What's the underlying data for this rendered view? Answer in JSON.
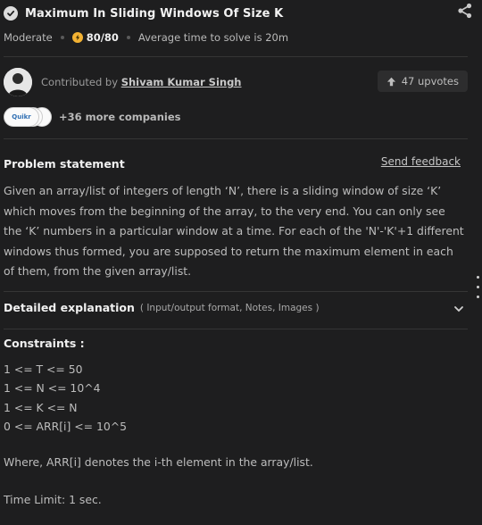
{
  "problem": {
    "title": "Maximum In Sliding Windows Of Size K",
    "difficulty": "Moderate",
    "score": "80/80",
    "avg_time": "Average time to solve is 20m"
  },
  "contributor": {
    "prefix": "Contributed by",
    "name": "Shivam Kumar Singh",
    "upvotes": "47 upvotes"
  },
  "companies": {
    "logo_text": "Quikr",
    "more": "+36 more companies"
  },
  "statement": {
    "heading": "Problem statement",
    "feedback": "Send feedback",
    "text": "Given an array/list of integers of length ‘N’, there is a sliding window of size ‘K’ which moves from the beginning of the array, to the very end. You can only see the ‘K’ numbers in a particular window at a time. For each of the 'N'-'K'+1 different windows thus formed, you are supposed to return the maximum element in each of them, from the given array/list."
  },
  "explanation": {
    "heading": "Detailed explanation",
    "sub": "( Input/output format, Notes, Images )"
  },
  "constraints": {
    "heading": "Constraints :",
    "items": [
      "1 <= T <= 50",
      "1 <= N <= 10^4",
      "1 <= K <= N",
      "0 <= ARR[i] <= 10^5"
    ],
    "note": "Where, ARR[i] denotes the i-th element in the array/list.",
    "time_limit": "Time Limit: 1 sec."
  },
  "colors": {
    "background": "#1e1e1f",
    "score_icon": "#f3b233"
  },
  "icons": [
    "check-circle-icon",
    "share-icon",
    "bolt-icon",
    "upvote-arrow-icon",
    "chevron-down-icon"
  ]
}
